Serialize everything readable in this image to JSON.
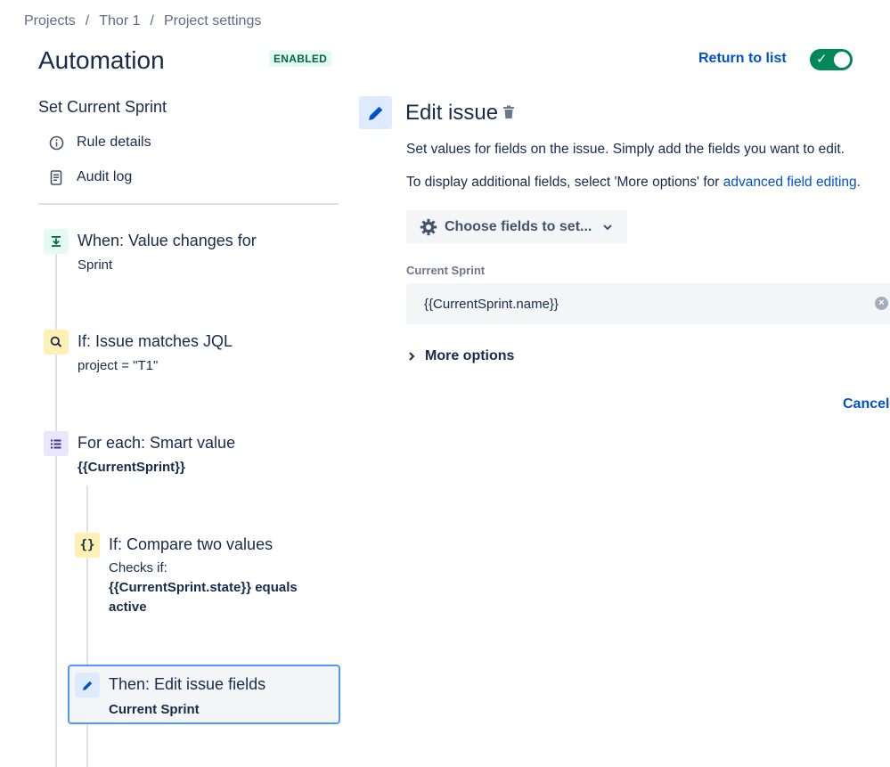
{
  "breadcrumb": {
    "items": [
      "Projects",
      "Thor 1",
      "Project settings"
    ],
    "separator": "/"
  },
  "header": {
    "title": "Automation",
    "status": "ENABLED",
    "return_link": "Return to list",
    "toggle_on": true
  },
  "sidebar": {
    "rule_name": "Set Current Sprint",
    "links": [
      {
        "label": "Rule details",
        "icon": "info-icon"
      },
      {
        "label": "Audit log",
        "icon": "document-icon"
      }
    ]
  },
  "steps": [
    {
      "type": "trigger",
      "icon": "trigger-icon",
      "title": "When: Value changes for",
      "sub": "Sprint"
    },
    {
      "type": "condition",
      "icon": "search-icon",
      "title": "If: Issue matches JQL",
      "sub": "project = \"T1\""
    },
    {
      "type": "branch",
      "icon": "list-icon",
      "title": "For each: Smart value",
      "sub": "{{CurrentSprint}}"
    },
    {
      "type": "condition",
      "icon": "braces-icon",
      "title": "If: Compare two values",
      "sub_line1": "Checks if:",
      "sub_line2": "{{CurrentSprint.state}} equals",
      "sub_line3": "active"
    },
    {
      "type": "action",
      "icon": "pencil-icon",
      "title": "Then: Edit issue fields",
      "sub": "Current Sprint",
      "selected": true
    }
  ],
  "panel": {
    "title": "Edit issue",
    "description": "Set values for fields on the issue. Simply add the fields you want to edit.",
    "description2_prefix": "To display additional fields, select 'More options' for ",
    "description2_link": "advanced field editing",
    "description2_suffix": ".",
    "choose_fields_label": "Choose fields to set...",
    "field_label": "Current Sprint",
    "field_value": "{{CurrentSprint.name}}",
    "more_options": "More options",
    "cancel": "Cancel"
  },
  "colors": {
    "accent": "#0052cc",
    "toggle": "#00875a",
    "selected_border": "#4c9aff"
  }
}
